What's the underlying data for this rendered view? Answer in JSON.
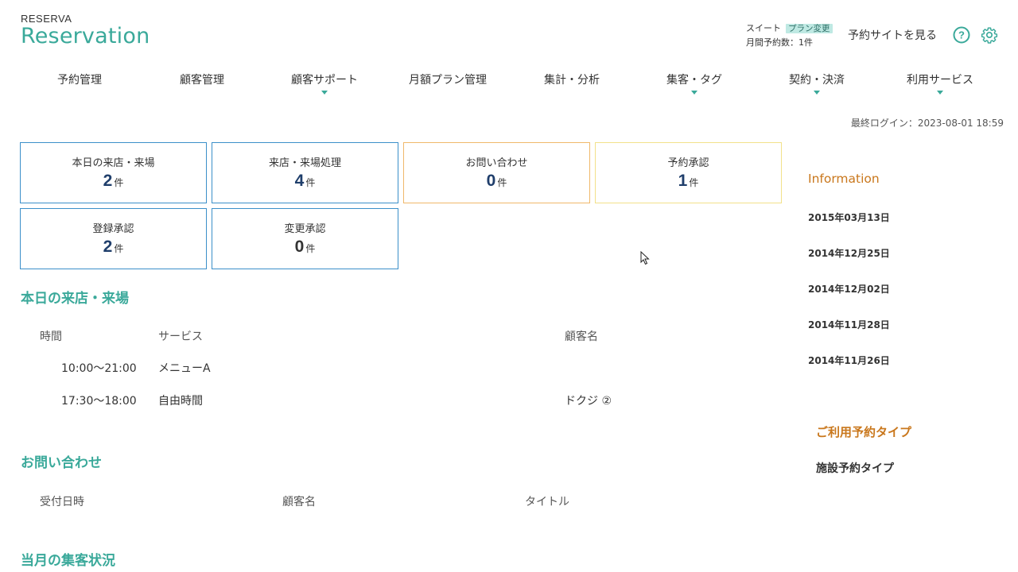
{
  "header": {
    "logo_small": "RESERVA",
    "logo_big": "Reservation",
    "plan_name": "スイート",
    "plan_change": "プラン変更",
    "monthly_count": "月間予約数：1件",
    "site_link": "予約サイトを見る"
  },
  "nav": {
    "items": [
      {
        "label": "予約管理"
      },
      {
        "label": "顧客管理"
      },
      {
        "label": "顧客サポート"
      },
      {
        "label": "月額プラン管理"
      },
      {
        "label": "集計・分析"
      },
      {
        "label": "集客・タグ"
      },
      {
        "label": "契約・決済"
      },
      {
        "label": "利用サービス"
      }
    ]
  },
  "last_login": "最終ログイン：2023-08-01 18:59",
  "cards": [
    {
      "label": "本日の来店・来場",
      "value": "2",
      "unit": "件"
    },
    {
      "label": "来店・来場処理",
      "value": "4",
      "unit": "件"
    },
    {
      "label": "お問い合わせ",
      "value": "0",
      "unit": "件"
    },
    {
      "label": "予約承認",
      "value": "1",
      "unit": "件"
    },
    {
      "label": "登録承認",
      "value": "2",
      "unit": "件"
    },
    {
      "label": "変更承認",
      "value": "0",
      "unit": "件"
    }
  ],
  "visits": {
    "title": "本日の来店・来場",
    "headers": {
      "time": "時間",
      "service": "サービス",
      "customer": "顧客名"
    },
    "rows": [
      {
        "time": "10:00～21:00",
        "service": "メニューA",
        "customer": ""
      },
      {
        "time": "17:30～18:00",
        "service": "自由時間",
        "customer": "ドクジ ②"
      }
    ]
  },
  "inquiries": {
    "title": "お問い合わせ",
    "headers": {
      "received": "受付日時",
      "customer": "顧客名",
      "subject": "タイトル"
    }
  },
  "monthly": {
    "title": "当月の集客状況"
  },
  "sidebar": {
    "info_title": "Information",
    "dates": [
      "2015年03月13日",
      "2014年12月25日",
      "2014年12月02日",
      "2014年11月28日",
      "2014年11月26日"
    ],
    "type_title": "ご利用予約タイプ",
    "type_value": "施設予約タイプ"
  },
  "colors": {
    "accent": "#3aa99a",
    "card_blue": "#3b8fc9",
    "card_orange": "#f0b86a",
    "card_yellow": "#f2e18a",
    "info_orange": "#c9771c"
  }
}
